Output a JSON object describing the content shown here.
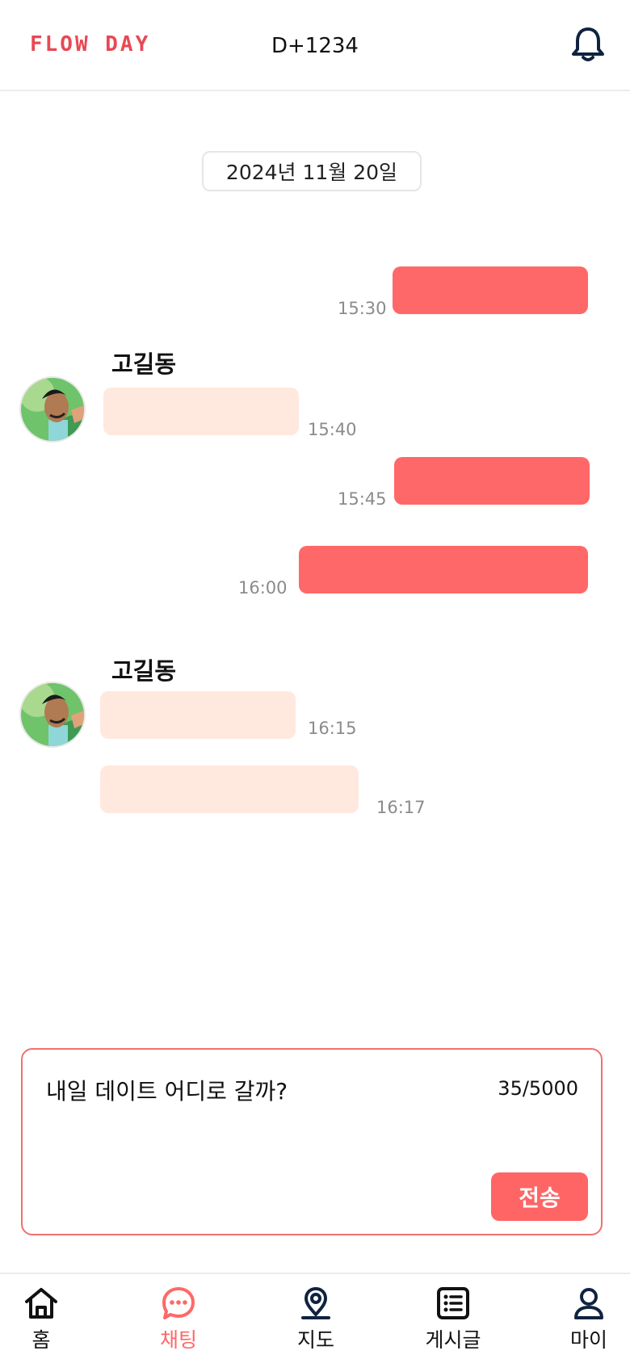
{
  "header": {
    "logo": "FLOW DAY",
    "dday": "D+1234",
    "bell_icon": "bell-icon"
  },
  "chat": {
    "date": "2024년 11월 20일",
    "partner_name": "고길동",
    "messages": [
      {
        "from": "me",
        "time": "15:30"
      },
      {
        "from": "partner",
        "time": "15:40"
      },
      {
        "from": "me",
        "time": "15:45"
      },
      {
        "from": "me",
        "time": "16:00"
      },
      {
        "from": "partner",
        "time": "16:15"
      },
      {
        "from": "partner",
        "time": "16:17"
      }
    ]
  },
  "composer": {
    "text": "내일 데이트 어디로 갈까?",
    "counter": "35/5000",
    "send_label": "전송"
  },
  "nav": {
    "items": [
      {
        "label": "홈",
        "icon": "home-icon"
      },
      {
        "label": "채팅",
        "icon": "chat-icon",
        "active": true
      },
      {
        "label": "지도",
        "icon": "map-pin-icon"
      },
      {
        "label": "게시글",
        "icon": "list-icon"
      },
      {
        "label": "마이",
        "icon": "user-icon"
      }
    ]
  },
  "colors": {
    "brand": "#e84855",
    "my_bubble": "#ff6868",
    "partner_bubble": "#ffe8de",
    "nav_icon": "#0f2340"
  }
}
